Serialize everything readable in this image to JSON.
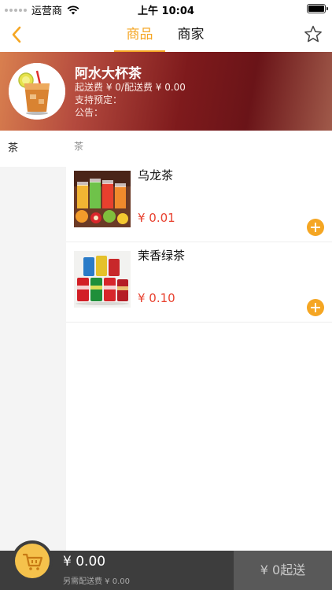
{
  "status_bar": {
    "carrier": "运营商",
    "time": "上午 10:04"
  },
  "nav": {
    "tabs": [
      {
        "label": "商品",
        "active": true
      },
      {
        "label": "商家",
        "active": false
      }
    ],
    "accent_color": "#f5a623"
  },
  "store": {
    "name": "阿水大杯茶",
    "fee_line": "起送费 ¥ 0/配送费 ¥ 0.00",
    "reservation_line": "支持预定：",
    "notice_line": "公告："
  },
  "categories": [
    {
      "label": "茶",
      "selected": true
    }
  ],
  "product_section": {
    "title": "茶",
    "products": [
      {
        "name": "乌龙茶",
        "price": "¥ 0.01",
        "image": "fruit-juice-cups-photo"
      },
      {
        "name": "茉香绿茶",
        "price": "¥ 0.10",
        "image": "soda-cans-photo"
      }
    ]
  },
  "cart": {
    "total": "¥ 0.00",
    "delivery_note": "另需配送费 ¥ 0.00",
    "min_order_label": "¥ 0起送"
  },
  "colors": {
    "price": "#e8412f",
    "cart_bar": "#3d3d3d",
    "cart_icon": "#f5c24c"
  }
}
